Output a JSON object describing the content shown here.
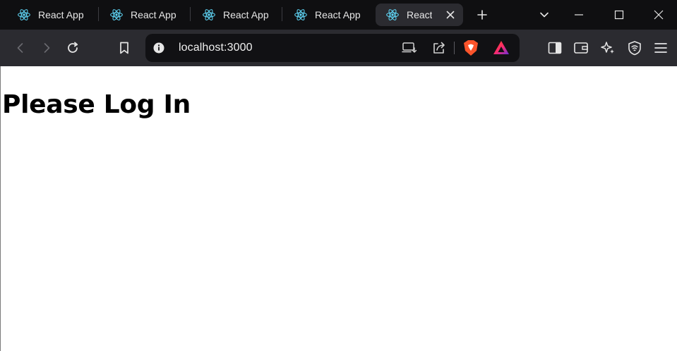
{
  "browser": {
    "tabs": [
      {
        "title": "React App",
        "active": false
      },
      {
        "title": "React App",
        "active": false
      },
      {
        "title": "React App",
        "active": false
      },
      {
        "title": "React App",
        "active": false
      },
      {
        "title": "React App",
        "active": true
      }
    ],
    "address_bar": {
      "url": "localhost:3000"
    }
  },
  "colors": {
    "react_logo": "#61dafb",
    "brave_orange": "#fb542b",
    "tabstrip_bg": "#0f0f11",
    "toolbar_bg": "#2b2b30",
    "omnibox_bg": "#111114"
  },
  "page": {
    "heading": "Please Log In"
  }
}
